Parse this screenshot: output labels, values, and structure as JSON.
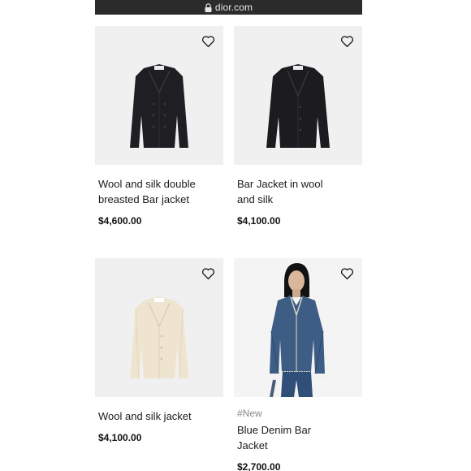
{
  "browser": {
    "url": "dior.com"
  },
  "products": [
    {
      "name": "Wool and silk double breasted Bar jacket",
      "price": "$4,600.00",
      "tag": ""
    },
    {
      "name": "Bar Jacket in wool and silk",
      "price": "$4,100.00",
      "tag": ""
    },
    {
      "name": "Wool and silk jacket",
      "price": "$4,100.00",
      "tag": ""
    },
    {
      "name": "Blue Denim Bar Jacket",
      "price": "$2,700.00",
      "tag": "#New"
    }
  ],
  "colors": {
    "card_background": "#f0f0f0",
    "url_bar": "#2b2b2b",
    "black_jacket": "#1f1f23",
    "ivory_jacket": "#efe4cf",
    "denim": "#3d5d85"
  }
}
